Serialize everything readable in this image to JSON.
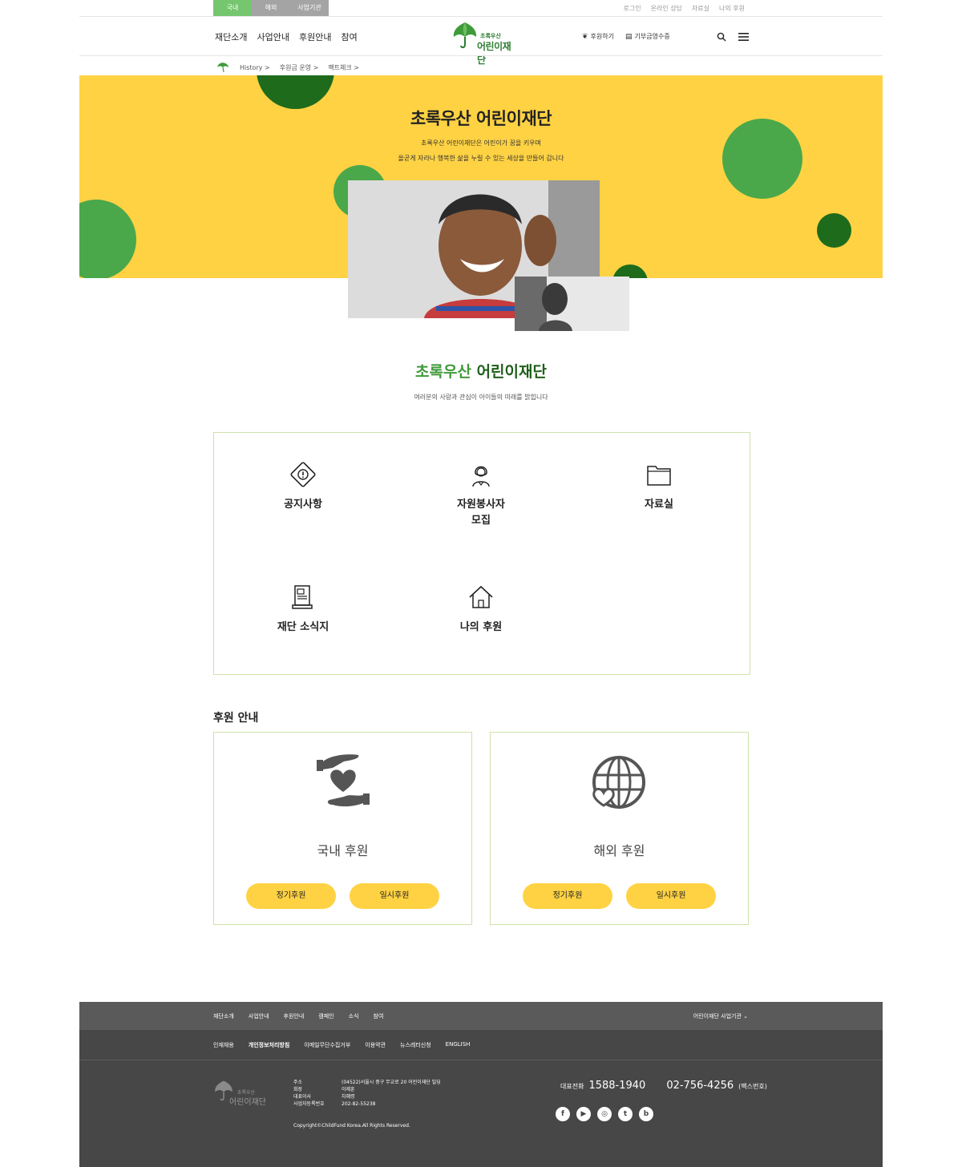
{
  "topbar": {
    "region_tabs": [
      {
        "label": "국내",
        "color": "#76c56f"
      },
      {
        "label": "해외",
        "color": "#a4a4a4"
      },
      {
        "label": "사업기관",
        "color": "#a4a4a4"
      }
    ],
    "util_links": [
      "로그인",
      "온라인 상담",
      "자료실",
      "나의 후원"
    ]
  },
  "header": {
    "gnb": [
      "재단소개",
      "사업안내",
      "후원안내",
      "참여"
    ],
    "logo_small": "초록우산",
    "logo_main": "어린이재단",
    "action_sponsor": "후원하기",
    "action_receipt": "기부금영수증",
    "search_icon": "search-icon",
    "menu_icon": "hamburger-icon"
  },
  "breadcrumb": [
    "History >",
    "후원금 운영 >",
    "팩트체크 >"
  ],
  "hero": {
    "title": "초록우산 어린이재단",
    "desc1": "초록우산 어린이재단은 어린이가 꿈을 키우며",
    "desc2": "올곧게 자라나 행복한 삶을 누릴 수 있는 세상을 만들어 갑니다",
    "bg_color": "#ffd243",
    "circle_dark": "#1e6b1c",
    "circle_light": "#4aa84a"
  },
  "intro": {
    "title_green": "초록우산",
    "title_dark": "어린이재단",
    "subtitle": "여러분의 사랑과 관심이 아이들의 미래를 밝힙니다"
  },
  "menu": {
    "items": [
      {
        "label": "공지사항",
        "icon": "warning-icon"
      },
      {
        "label": "자원봉사자",
        "label2": "모집",
        "icon": "volunteer-icon"
      },
      {
        "label": "자료실",
        "icon": "folder-icon"
      },
      {
        "label": "재단 소식지",
        "icon": "newsletter-icon"
      },
      {
        "label": "나의 후원",
        "icon": "home-icon"
      }
    ]
  },
  "support": {
    "title": "후원 안내",
    "cards": [
      {
        "title": "국내 후원",
        "icon": "hands-heart-icon",
        "btn1": "정기후원",
        "btn2": "일시후원"
      },
      {
        "title": "해외 후원",
        "icon": "globe-heart-icon",
        "btn1": "정기후원",
        "btn2": "일시후원"
      }
    ]
  },
  "footer": {
    "nav1": [
      "재단소개",
      "사업안내",
      "후원안내",
      "캠페인",
      "소식",
      "참여"
    ],
    "nav1_right": "어린이재단 사업기관",
    "nav2": [
      "인재채용",
      "개인정보처리방침",
      "이메일무단수집거부",
      "이용약관",
      "뉴스레터신청",
      "ENGLISH"
    ],
    "info": [
      {
        "k": "주소",
        "v": "(04522)서울시 중구 무교로 20 어린이재단 빌딩"
      },
      {
        "k": "회장",
        "v": "이제훈"
      },
      {
        "k": "대표이사",
        "v": "차혜령"
      },
      {
        "k": "사업자등록번호",
        "v": "202-82-55238"
      }
    ],
    "copyright": "Copyright©ChildFund Korea.All Rights Reserved.",
    "tel_label": "대표전화",
    "tel": "1588-1940",
    "fax": "02-756-4256",
    "fax_label": "(팩스번호)",
    "logo_small": "초록우산",
    "logo_main": "어린이재단",
    "sns": [
      "facebook-icon",
      "youtube-icon",
      "instagram-icon",
      "twitter-icon",
      "blog-icon"
    ]
  }
}
